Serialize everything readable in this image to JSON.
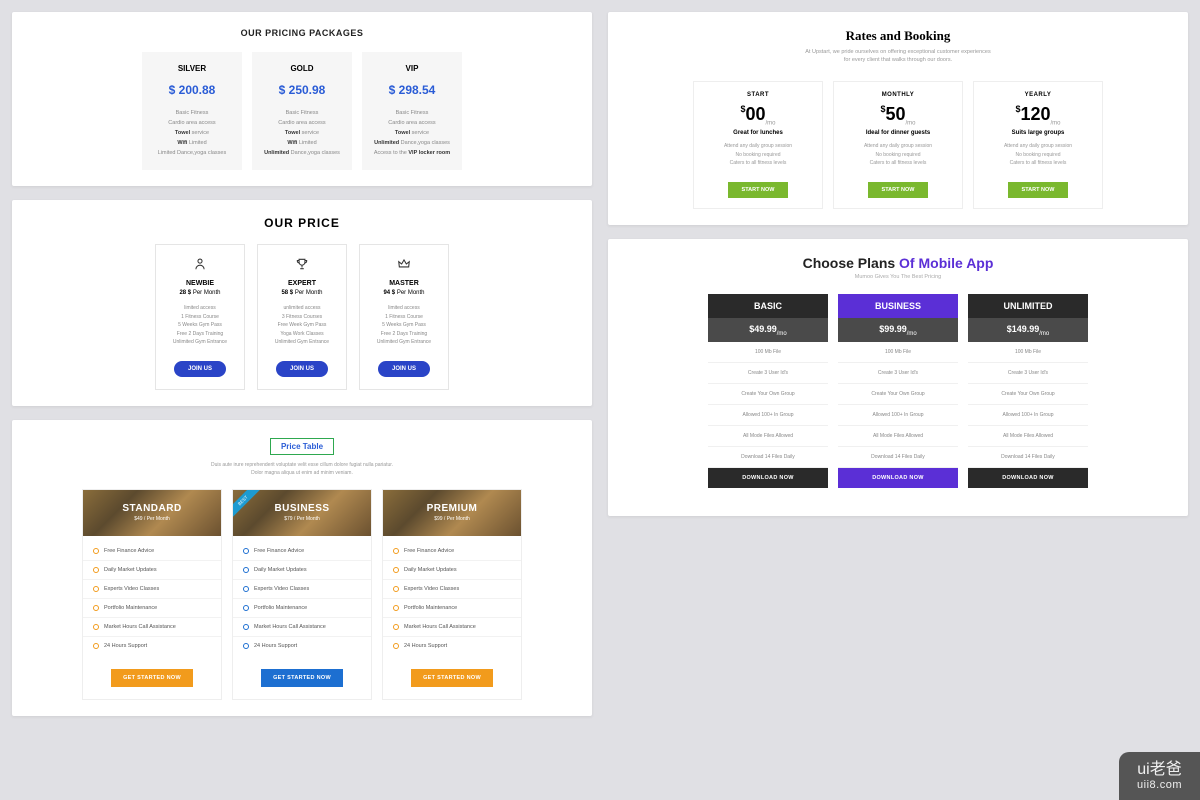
{
  "s1": {
    "title": "OUR PRICING PACKAGES",
    "tiers": [
      {
        "name": "SILVER",
        "price": "$ 200.88",
        "features": [
          "Basic Fitness",
          "Cardio area access",
          "<b>Towel</b> service",
          "<b>Wifi</b> Limited",
          "Limited Dance,yoga classes"
        ]
      },
      {
        "name": "GOLD",
        "price": "$ 250.98",
        "features": [
          "Basic Fitness",
          "Cardio area access",
          "<b>Towel</b> service",
          "<b>Wifi</b> Limited",
          "<b>Unlimited</b> Dance,yoga classes"
        ]
      },
      {
        "name": "VIP",
        "price": "$ 298.54",
        "features": [
          "Basic Fitness",
          "Cardio area access",
          "<b>Towel</b> service",
          "<b>Unlimited</b> Dance,yoga classes",
          "Access to the <b>VIP locker room</b>"
        ]
      }
    ]
  },
  "s2": {
    "title": "OUR PRICE",
    "tiers": [
      {
        "icon": "person-icon",
        "name": "NEWBIE",
        "price_amount": "28 $",
        "price_period": "Per Month",
        "features": [
          "limited access",
          "1 Fitness Course",
          "5 Weeks Gym Pass",
          "Free 2 Days Training",
          "Unlimited Gym Entrance"
        ],
        "cta": "JOIN US"
      },
      {
        "icon": "trophy-icon",
        "name": "EXPERT",
        "price_amount": "58 $",
        "price_period": "Per Month",
        "features": [
          "unlimited access",
          "3 Fitness Courses",
          "Free Week Gym Pass",
          "Yoga Work Classes",
          "Unlimited Gym Entrance"
        ],
        "cta": "JOIN US"
      },
      {
        "icon": "crown-icon",
        "name": "MASTER",
        "price_amount": "94 $",
        "price_period": "Per Month",
        "features": [
          "limited access",
          "1 Fitness Course",
          "5 Weeks Gym Pass",
          "Free 2 Days Training",
          "Unlimited Gym Entrance"
        ],
        "cta": "JOIN US"
      }
    ]
  },
  "s3": {
    "badge": "Price Table",
    "sub": "Duis aute irure reprehenderit voluptate velit esse cillum dolore fugiat nulla pariatur.\nDolor magna aliqua ut enim ad minim veniam.",
    "tiers": [
      {
        "name": "STANDARD",
        "price": "$49 / Per Month",
        "ribbon": false,
        "btn": "GET STARTED NOW",
        "btn_style": "o",
        "features": [
          "Free Finance Advice",
          "Daily Market Updates",
          "Experts Video Classes",
          "Portfolio Maintenance",
          "Market Hours Call Assistance",
          "24 Hours Support"
        ]
      },
      {
        "name": "BUSINESS",
        "price": "$79 / Per Month",
        "ribbon": true,
        "ribbon_text": "BEST",
        "btn": "GET STARTED NOW",
        "btn_style": "b",
        "features": [
          "Free Finance Advice",
          "Daily Market Updates",
          "Experts Video Classes",
          "Portfolio Maintenance",
          "Market Hours Call Assistance",
          "24 Hours Support"
        ]
      },
      {
        "name": "PREMIUM",
        "price": "$99 / Per Month",
        "ribbon": false,
        "btn": "GET STARTED NOW",
        "btn_style": "o",
        "features": [
          "Free Finance Advice",
          "Daily Market Updates",
          "Experts Video Classes",
          "Portfolio Maintenance",
          "Market Hours Call Assistance",
          "24 Hours Support"
        ]
      }
    ]
  },
  "s4": {
    "title": "Rates and Booking",
    "sub": "At Upstart, we pride ourselves on offering exceptional customer experiences\nfor every client that walks through our doors.",
    "tiers": [
      {
        "name": "START",
        "currency": "$",
        "amount": "00",
        "per": "/mo",
        "tag": "Great for lunches",
        "features": [
          "Attend any daily group session",
          "No booking required",
          "Caters to all fitness levels"
        ],
        "cta": "START NOW"
      },
      {
        "name": "MONTHLY",
        "currency": "$",
        "amount": "50",
        "per": "/mo",
        "tag": "Ideal for dinner guests",
        "features": [
          "Attend any daily group session",
          "No booking required",
          "Caters to all fitness levels"
        ],
        "cta": "START NOW"
      },
      {
        "name": "YEARLY",
        "currency": "$",
        "amount": "120",
        "per": "/mo",
        "tag": "Suits large groups",
        "features": [
          "Attend any daily group session",
          "No booking required",
          "Caters to all fitness levels"
        ],
        "cta": "START NOW"
      }
    ]
  },
  "s5": {
    "title_a": "Choose Plans ",
    "title_b": "Of Mobile App",
    "sub": "Mumoo Gives You The Best Pricing",
    "tiers": [
      {
        "name": "BASIC",
        "price": "$49.99",
        "per": "/mo",
        "hl": false,
        "btn": "DOWNLOAD NOW",
        "features": [
          "100 Mb File",
          "Create 3 User Id's",
          "Create Your Own Group",
          "Allowed 100+ In Group",
          "All Mode Files Allowed",
          "Download 14 Files Daily"
        ]
      },
      {
        "name": "BUSINESS",
        "price": "$99.99",
        "per": "/mo",
        "hl": true,
        "btn": "DOWNLOAD NOW",
        "features": [
          "100 Mb File",
          "Create 3 User Id's",
          "Create Your Own Group",
          "Allowed 100+ In Group",
          "All Mode Files Allowed",
          "Download 14 Files Daily"
        ]
      },
      {
        "name": "UNLIMITED",
        "price": "$149.99",
        "per": "/mo",
        "hl": false,
        "btn": "DOWNLOAD NOW",
        "features": [
          "100 Mb File",
          "Create 3 User Id's",
          "Create Your Own Group",
          "Allowed 100+ In Group",
          "All Mode Files Allowed",
          "Download 14 Files Daily"
        ]
      }
    ]
  },
  "watermark": {
    "cn": "ui老爸",
    "url": "uii8.com"
  }
}
